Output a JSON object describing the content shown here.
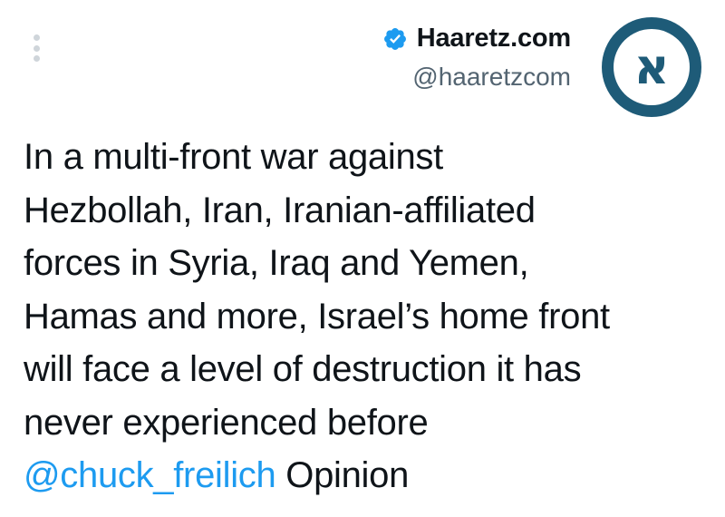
{
  "author": {
    "display_name": "Haaretz.com",
    "handle": "@haaretzcom",
    "verified": true,
    "avatar_letter": "א"
  },
  "tweet": {
    "text": "In a multi-front war against\nHezbollah, Iran, Iranian-affiliated\nforces in Syria, Iraq and Yemen,\nHamas and more, Israel’s home front\nwill face a level of destruction it has\nnever experienced before\n",
    "mention": "@chuck_freilich",
    "suffix": " Opinion"
  },
  "colors": {
    "link": "#1d9bf0",
    "verified": "#1d9bf0",
    "avatar_ring": "#1e5b78",
    "text": "#0f1419",
    "muted": "#536471"
  },
  "icons": {
    "more": "more-vertical-icon",
    "verified": "verified-badge-icon"
  }
}
